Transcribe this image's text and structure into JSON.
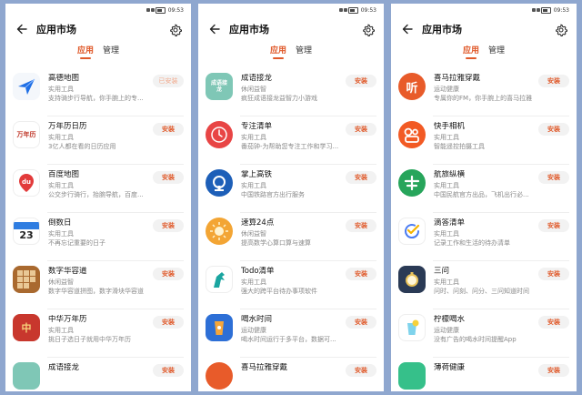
{
  "status": {
    "time": "09:53"
  },
  "header": {
    "title": "应用市场"
  },
  "tabs": [
    {
      "label": "应用"
    },
    {
      "label": "管理"
    }
  ],
  "panels": [
    {
      "apps": [
        {
          "name": "高德地图",
          "category": "实用工具",
          "desc": "支持骑步行导航，你手腕上的专...",
          "button": "已安装",
          "icon_label": ""
        },
        {
          "name": "万年历日历",
          "category": "实用工具",
          "desc": "3亿人都在看的日历应用",
          "button": "安装",
          "icon_label": "万年历"
        },
        {
          "name": "百度地图",
          "category": "实用工具",
          "desc": "公交步行骑行，抬腕导航，百度...",
          "button": "安装",
          "icon_label": "du"
        },
        {
          "name": "倒数日",
          "category": "实用工具",
          "desc": "不再忘记重要的日子",
          "button": "安装",
          "icon_label": "23"
        },
        {
          "name": "数字华容道",
          "category": "休闲益智",
          "desc": "数字华容道拼图，数字滑块华容道",
          "button": "安装",
          "icon_label": ""
        },
        {
          "name": "中华万年历",
          "category": "实用工具",
          "desc": "挑日子选日子就用中华万年历",
          "button": "安装",
          "icon_label": "中"
        },
        {
          "name": "成语接龙",
          "category": "",
          "desc": "",
          "button": "安装",
          "icon_label": ""
        }
      ]
    },
    {
      "apps": [
        {
          "name": "成语接龙",
          "category": "休闲益智",
          "desc": "疯狂成语接龙益智力小游戏",
          "button": "安装",
          "icon_label": "成语接龙"
        },
        {
          "name": "专注清单",
          "category": "实用工具",
          "desc": "番茄钟-为帮助您专注工作和学习...",
          "button": "安装",
          "icon_label": ""
        },
        {
          "name": "掌上高铁",
          "category": "实用工具",
          "desc": "中国铁路官方出行服务",
          "button": "安装",
          "icon_label": ""
        },
        {
          "name": "速算24点",
          "category": "休闲益智",
          "desc": "提高数学心算口算与速算",
          "button": "安装",
          "icon_label": ""
        },
        {
          "name": "Todo清单",
          "category": "实用工具",
          "desc": "强大的跨平台待办事项软件",
          "button": "安装",
          "icon_label": ""
        },
        {
          "name": "喝水时间",
          "category": "运动健康",
          "desc": "喝水时间运行于多平台，数据可...",
          "button": "安装",
          "icon_label": ""
        },
        {
          "name": "喜马拉雅穿戴",
          "category": "",
          "desc": "",
          "button": "安装",
          "icon_label": ""
        }
      ]
    },
    {
      "apps": [
        {
          "name": "喜马拉雅穿戴",
          "category": "运动健康",
          "desc": "专属你的FM，你手腕上的喜马拉雅",
          "button": "安装",
          "icon_label": "听"
        },
        {
          "name": "快手相机",
          "category": "实用工具",
          "desc": "智能遥控拍摄工具",
          "button": "安装",
          "icon_label": ""
        },
        {
          "name": "航旅纵横",
          "category": "实用工具",
          "desc": "中国民航官方出品，飞机出行必...",
          "button": "安装",
          "icon_label": ""
        },
        {
          "name": "滴答清单",
          "category": "实用工具",
          "desc": "记录工作和生活的待办清单",
          "button": "安装",
          "icon_label": ""
        },
        {
          "name": "三问",
          "category": "实用工具",
          "desc": "问时、问刻、问分、三问知道时间",
          "button": "安装",
          "icon_label": ""
        },
        {
          "name": "柠檬喝水",
          "category": "运动健康",
          "desc": "没有广告的喝水时间提醒App",
          "button": "安装",
          "icon_label": ""
        },
        {
          "name": "薄荷健康",
          "category": "",
          "desc": "",
          "button": "安装",
          "icon_label": ""
        }
      ]
    }
  ]
}
